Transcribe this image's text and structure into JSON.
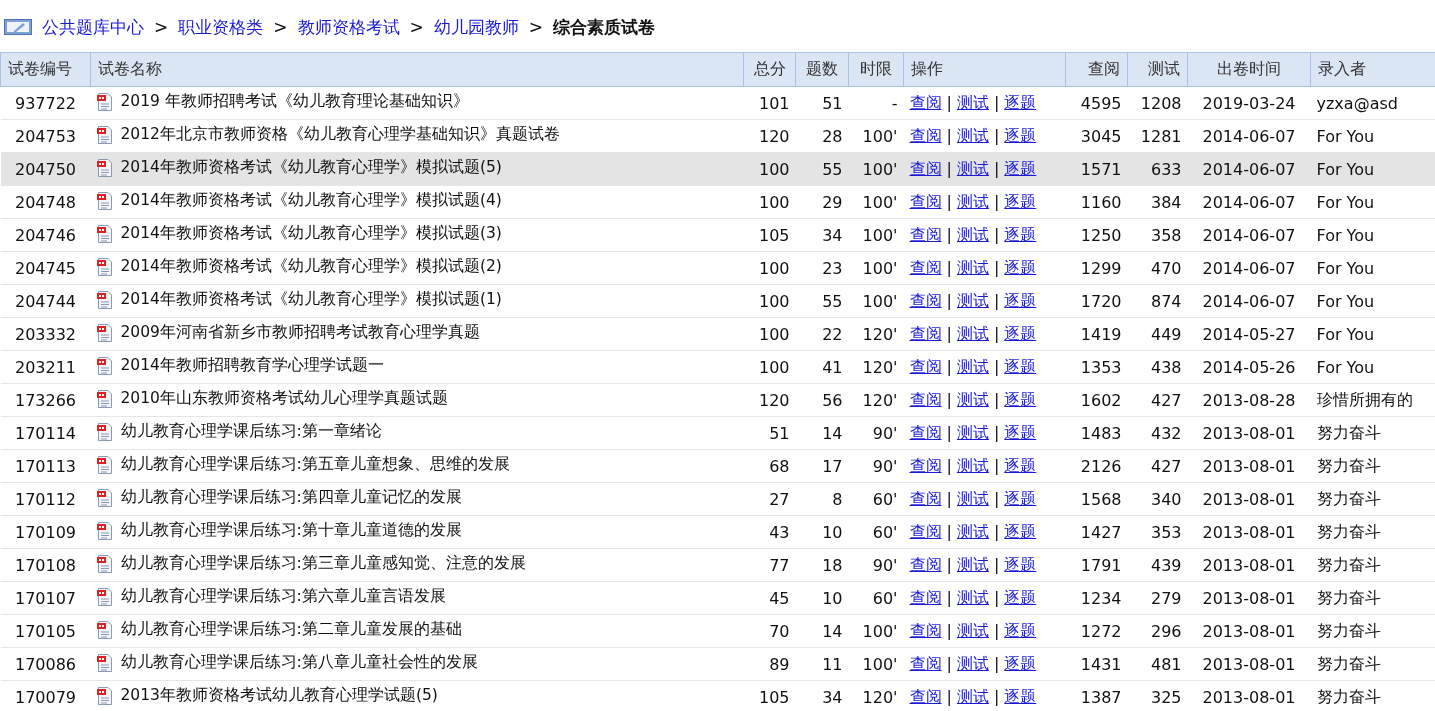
{
  "breadcrumb": {
    "links": [
      "公共题库中心",
      "职业资格类",
      "教师资格考试",
      "幼儿园教师"
    ],
    "separator": ">",
    "current": "综合素质试卷"
  },
  "table": {
    "columns": [
      "试卷编号",
      "试卷名称",
      "总分",
      "题数",
      "时限",
      "操作",
      "查阅",
      "测试",
      "出卷时间",
      "录入者"
    ],
    "rows": [
      {
        "id": "937722",
        "name": "2019 年教师招聘考试《幼儿教育理论基础知识》",
        "score": "101",
        "count": "51",
        "time": "-",
        "actions": [
          "查阅",
          "测试",
          "逐题"
        ],
        "separator": "|",
        "views": "4595",
        "tests": "1208",
        "date": "2019-03-24",
        "author": "yzxa@asd",
        "selected": false
      },
      {
        "id": "204753",
        "name": "2012年北京市教师资格《幼儿教育心理学基础知识》真题试卷",
        "score": "120",
        "count": "28",
        "time": "100'",
        "actions": [
          "查阅",
          "测试",
          "逐题"
        ],
        "separator": "|",
        "views": "3045",
        "tests": "1281",
        "date": "2014-06-07",
        "author": "For You",
        "selected": false
      },
      {
        "id": "204750",
        "name": "2014年教师资格考试《幼儿教育心理学》模拟试题(5)",
        "score": "100",
        "count": "55",
        "time": "100'",
        "actions": [
          "查阅",
          "测试",
          "逐题"
        ],
        "separator": "|",
        "views": "1571",
        "tests": "633",
        "date": "2014-06-07",
        "author": "For You",
        "selected": true
      },
      {
        "id": "204748",
        "name": "2014年教师资格考试《幼儿教育心理学》模拟试题(4)",
        "score": "100",
        "count": "29",
        "time": "100'",
        "actions": [
          "查阅",
          "测试",
          "逐题"
        ],
        "separator": "|",
        "views": "1160",
        "tests": "384",
        "date": "2014-06-07",
        "author": "For You",
        "selected": false
      },
      {
        "id": "204746",
        "name": "2014年教师资格考试《幼儿教育心理学》模拟试题(3)",
        "score": "105",
        "count": "34",
        "time": "100'",
        "actions": [
          "查阅",
          "测试",
          "逐题"
        ],
        "separator": "|",
        "views": "1250",
        "tests": "358",
        "date": "2014-06-07",
        "author": "For You",
        "selected": false
      },
      {
        "id": "204745",
        "name": "2014年教师资格考试《幼儿教育心理学》模拟试题(2)",
        "score": "100",
        "count": "23",
        "time": "100'",
        "actions": [
          "查阅",
          "测试",
          "逐题"
        ],
        "separator": "|",
        "views": "1299",
        "tests": "470",
        "date": "2014-06-07",
        "author": "For You",
        "selected": false
      },
      {
        "id": "204744",
        "name": "2014年教师资格考试《幼儿教育心理学》模拟试题(1)",
        "score": "100",
        "count": "55",
        "time": "100'",
        "actions": [
          "查阅",
          "测试",
          "逐题"
        ],
        "separator": "|",
        "views": "1720",
        "tests": "874",
        "date": "2014-06-07",
        "author": "For You",
        "selected": false
      },
      {
        "id": "203332",
        "name": "2009年河南省新乡市教师招聘考试教育心理学真题",
        "score": "100",
        "count": "22",
        "time": "120'",
        "actions": [
          "查阅",
          "测试",
          "逐题"
        ],
        "separator": "|",
        "views": "1419",
        "tests": "449",
        "date": "2014-05-27",
        "author": "For You",
        "selected": false
      },
      {
        "id": "203211",
        "name": "2014年教师招聘教育学心理学试题一",
        "score": "100",
        "count": "41",
        "time": "120'",
        "actions": [
          "查阅",
          "测试",
          "逐题"
        ],
        "separator": "|",
        "views": "1353",
        "tests": "438",
        "date": "2014-05-26",
        "author": "For You",
        "selected": false
      },
      {
        "id": "173266",
        "name": "2010年山东教师资格考试幼儿心理学真题试题",
        "score": "120",
        "count": "56",
        "time": "120'",
        "actions": [
          "查阅",
          "测试",
          "逐题"
        ],
        "separator": "|",
        "views": "1602",
        "tests": "427",
        "date": "2013-08-28",
        "author": "珍惜所拥有的",
        "selected": false
      },
      {
        "id": "170114",
        "name": "幼儿教育心理学课后练习:第一章绪论",
        "score": "51",
        "count": "14",
        "time": "90'",
        "actions": [
          "查阅",
          "测试",
          "逐题"
        ],
        "separator": "|",
        "views": "1483",
        "tests": "432",
        "date": "2013-08-01",
        "author": "努力奋斗",
        "selected": false
      },
      {
        "id": "170113",
        "name": "幼儿教育心理学课后练习:第五章儿童想象、思维的发展",
        "score": "68",
        "count": "17",
        "time": "90'",
        "actions": [
          "查阅",
          "测试",
          "逐题"
        ],
        "separator": "|",
        "views": "2126",
        "tests": "427",
        "date": "2013-08-01",
        "author": "努力奋斗",
        "selected": false
      },
      {
        "id": "170112",
        "name": "幼儿教育心理学课后练习:第四章儿童记忆的发展",
        "score": "27",
        "count": "8",
        "time": "60'",
        "actions": [
          "查阅",
          "测试",
          "逐题"
        ],
        "separator": "|",
        "views": "1568",
        "tests": "340",
        "date": "2013-08-01",
        "author": "努力奋斗",
        "selected": false
      },
      {
        "id": "170109",
        "name": "幼儿教育心理学课后练习:第十章儿童道德的发展",
        "score": "43",
        "count": "10",
        "time": "60'",
        "actions": [
          "查阅",
          "测试",
          "逐题"
        ],
        "separator": "|",
        "views": "1427",
        "tests": "353",
        "date": "2013-08-01",
        "author": "努力奋斗",
        "selected": false
      },
      {
        "id": "170108",
        "name": "幼儿教育心理学课后练习:第三章儿童感知觉、注意的发展",
        "score": "77",
        "count": "18",
        "time": "90'",
        "actions": [
          "查阅",
          "测试",
          "逐题"
        ],
        "separator": "|",
        "views": "1791",
        "tests": "439",
        "date": "2013-08-01",
        "author": "努力奋斗",
        "selected": false
      },
      {
        "id": "170107",
        "name": "幼儿教育心理学课后练习:第六章儿童言语发展",
        "score": "45",
        "count": "10",
        "time": "60'",
        "actions": [
          "查阅",
          "测试",
          "逐题"
        ],
        "separator": "|",
        "views": "1234",
        "tests": "279",
        "date": "2013-08-01",
        "author": "努力奋斗",
        "selected": false
      },
      {
        "id": "170105",
        "name": "幼儿教育心理学课后练习:第二章儿童发展的基础",
        "score": "70",
        "count": "14",
        "time": "100'",
        "actions": [
          "查阅",
          "测试",
          "逐题"
        ],
        "separator": "|",
        "views": "1272",
        "tests": "296",
        "date": "2013-08-01",
        "author": "努力奋斗",
        "selected": false
      },
      {
        "id": "170086",
        "name": "幼儿教育心理学课后练习:第八章儿童社会性的发展",
        "score": "89",
        "count": "11",
        "time": "100'",
        "actions": [
          "查阅",
          "测试",
          "逐题"
        ],
        "separator": "|",
        "views": "1431",
        "tests": "481",
        "date": "2013-08-01",
        "author": "努力奋斗",
        "selected": false
      },
      {
        "id": "170079",
        "name": "2013年教师资格考试幼儿教育心理学试题(5)",
        "score": "105",
        "count": "34",
        "time": "120'",
        "actions": [
          "查阅",
          "测试",
          "逐题"
        ],
        "separator": "|",
        "views": "1387",
        "tests": "325",
        "date": "2013-08-01",
        "author": "努力奋斗",
        "selected": false
      }
    ]
  }
}
